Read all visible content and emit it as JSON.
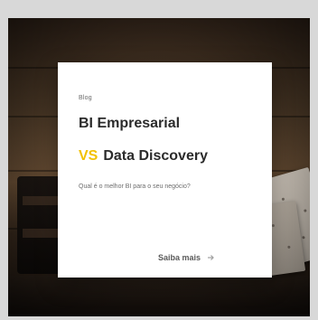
{
  "card": {
    "kicker": "Blog",
    "title_line1": "BI Empresarial",
    "vs": "VS",
    "title_line2_rest": "Data Discovery",
    "subtitle": "Qual é o melhor BI para o seu negócio?",
    "cta_label": "Saiba mais"
  },
  "icons": {
    "cta": "arrow-right-icon"
  },
  "colors": {
    "accent": "#f2c100",
    "card_bg": "#ffffff",
    "frame_bg": "#d8d8d8"
  }
}
